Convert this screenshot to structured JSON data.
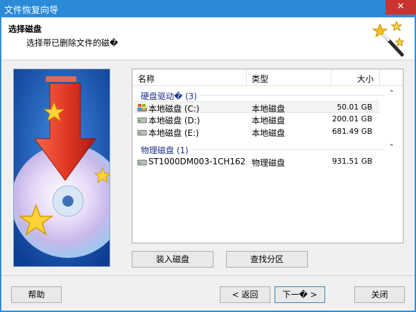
{
  "window": {
    "title": "文件恢复向导",
    "close_glyph": "✕"
  },
  "header": {
    "heading": "选择磁盘",
    "subheading": "选择带已删除文件的磁�"
  },
  "columns": {
    "name": "名称",
    "type": "类型",
    "size": "大小"
  },
  "groups": [
    {
      "label": "硬盘驱动� (3)",
      "items": [
        {
          "name": "本地磁盘 (C:)",
          "type": "本地磁盘",
          "size": "50.01 GB",
          "icon": "windows-drive-icon"
        },
        {
          "name": "本地磁盘 (D:)",
          "type": "本地磁盘",
          "size": "200.01 GB",
          "icon": "hard-drive-icon"
        },
        {
          "name": "本地磁盘 (E:)",
          "type": "本地磁盘",
          "size": "681.49 GB",
          "icon": "hard-drive-icon"
        }
      ]
    },
    {
      "label": "物理磁盘 (1)",
      "items": [
        {
          "name": "ST1000DM003-1CH162",
          "type": "物理磁盘",
          "size": "931.51 GB",
          "icon": "hard-drive-icon"
        }
      ]
    }
  ],
  "actions": {
    "mount": "装入磁盘",
    "find_partitions": "查找分区"
  },
  "footer": {
    "help": "帮助",
    "back": "< 返回",
    "next": "下一� >",
    "close": "关闭"
  },
  "collapse_glyph": "⌃"
}
